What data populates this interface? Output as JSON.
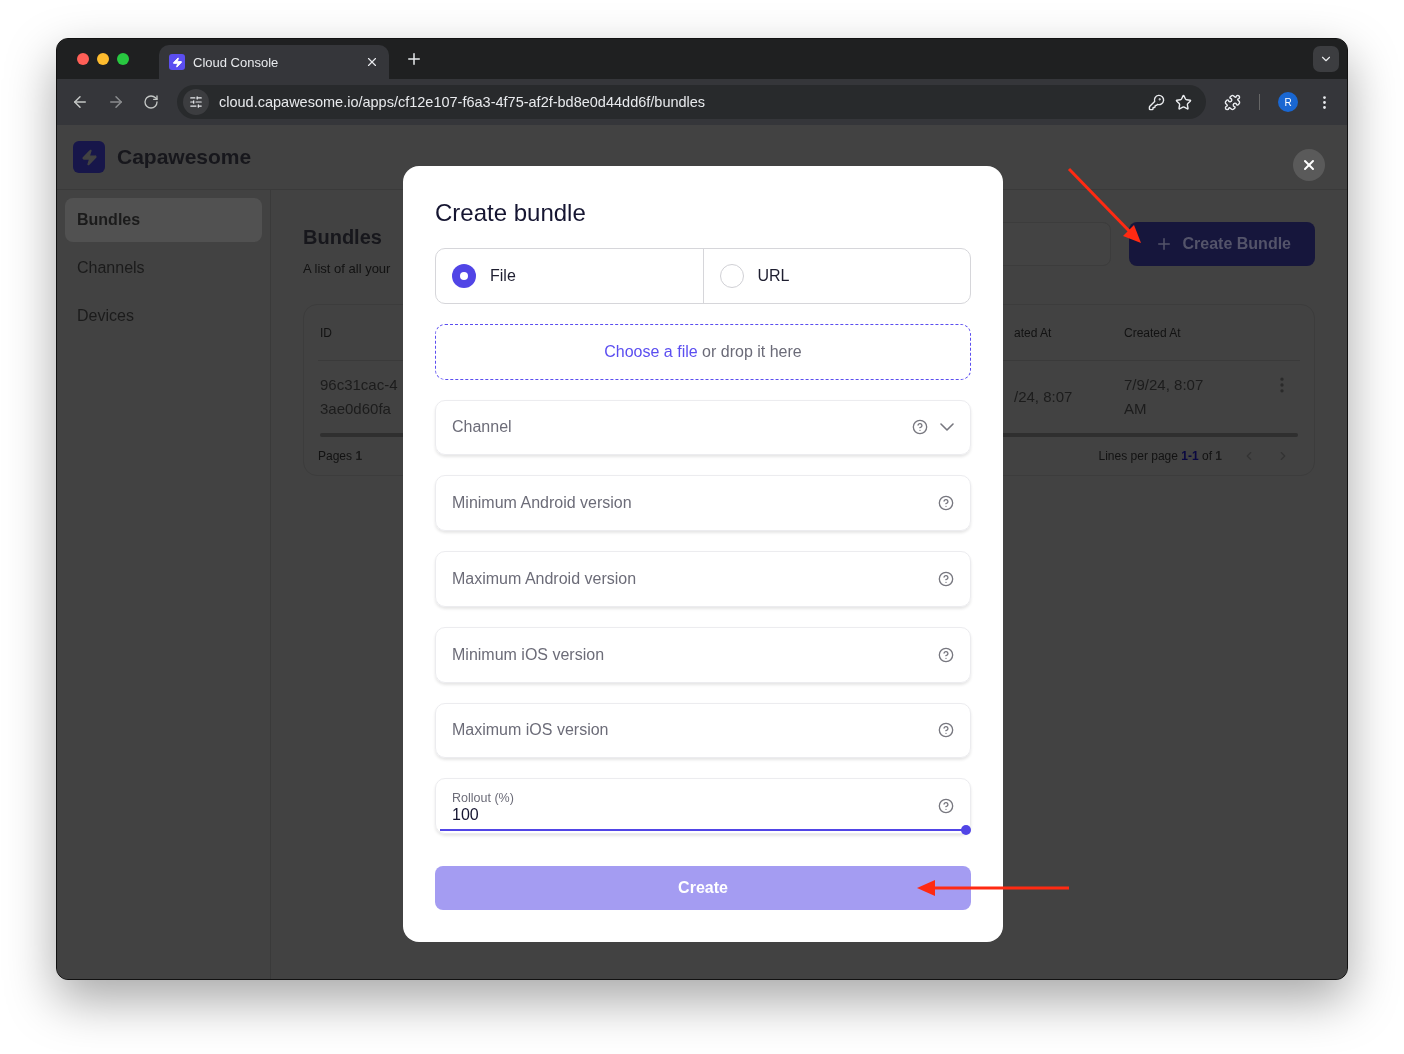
{
  "browser": {
    "tab_title": "Cloud Console",
    "url": "cloud.capawesome.io/apps/cf12e107-f6a3-4f75-af2f-bd8e0d44dd6f/bundles",
    "profile_initial": "R"
  },
  "app": {
    "brand": "Capawesome",
    "nav": [
      {
        "label": "Bundles",
        "selected": true
      },
      {
        "label": "Channels",
        "selected": false
      },
      {
        "label": "Devices",
        "selected": false
      }
    ],
    "page_title": "Bundles",
    "page_subtitle": "A list of all your",
    "create_button": "Create Bundle",
    "table": {
      "columns": [
        "ID",
        "ated At",
        "Created At"
      ],
      "rows": [
        {
          "cells": [
            [
              "96c31cac-4",
              "3ae0d60fa"
            ],
            [
              "/24, 8:07"
            ],
            [
              "7/9/24, 8:07",
              "AM"
            ]
          ]
        }
      ]
    },
    "pagination": {
      "pages_label": "Pages",
      "pages_value": "1",
      "lines_label": "Lines per page",
      "range": "1-1",
      "of": "of",
      "total": "1"
    }
  },
  "modal": {
    "title": "Create bundle",
    "source_options": [
      {
        "label": "File",
        "selected": true
      },
      {
        "label": "URL",
        "selected": false
      }
    ],
    "dropzone": {
      "link": "Choose a file",
      "text": "or drop it here"
    },
    "fields": [
      {
        "kind": "select",
        "placeholder": "Channel"
      },
      {
        "kind": "input",
        "placeholder": "Minimum Android version"
      },
      {
        "kind": "input",
        "placeholder": "Maximum Android version"
      },
      {
        "kind": "input",
        "placeholder": "Minimum iOS version"
      },
      {
        "kind": "input",
        "placeholder": "Maximum iOS version"
      },
      {
        "kind": "slider",
        "label": "Rollout (%)",
        "value": "100",
        "level": 1
      }
    ],
    "submit": {
      "label": "Create",
      "disabled": true
    }
  }
}
